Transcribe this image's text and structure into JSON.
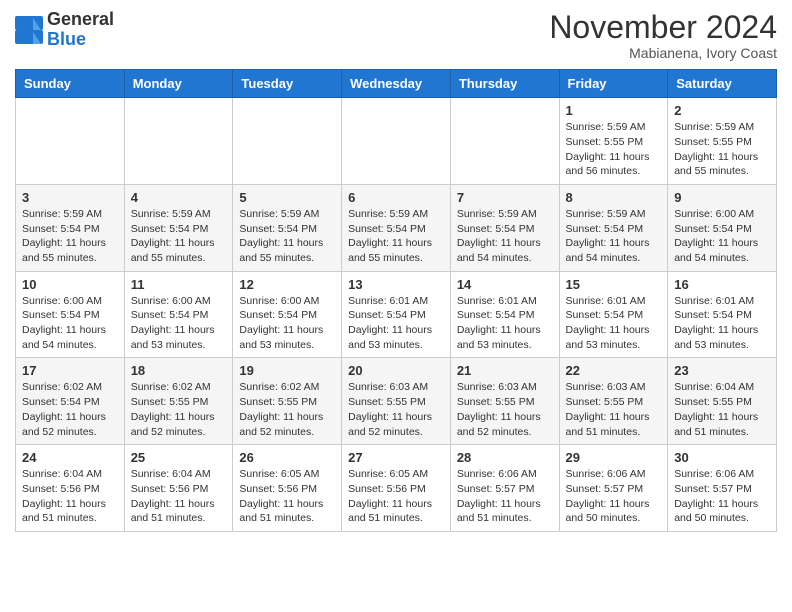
{
  "header": {
    "logo_general": "General",
    "logo_blue": "Blue",
    "month_title": "November 2024",
    "location": "Mabianena, Ivory Coast"
  },
  "weekdays": [
    "Sunday",
    "Monday",
    "Tuesday",
    "Wednesday",
    "Thursday",
    "Friday",
    "Saturday"
  ],
  "weeks": [
    [
      {
        "day": "",
        "info": ""
      },
      {
        "day": "",
        "info": ""
      },
      {
        "day": "",
        "info": ""
      },
      {
        "day": "",
        "info": ""
      },
      {
        "day": "",
        "info": ""
      },
      {
        "day": "1",
        "info": "Sunrise: 5:59 AM\nSunset: 5:55 PM\nDaylight: 11 hours\nand 56 minutes."
      },
      {
        "day": "2",
        "info": "Sunrise: 5:59 AM\nSunset: 5:55 PM\nDaylight: 11 hours\nand 55 minutes."
      }
    ],
    [
      {
        "day": "3",
        "info": "Sunrise: 5:59 AM\nSunset: 5:54 PM\nDaylight: 11 hours\nand 55 minutes."
      },
      {
        "day": "4",
        "info": "Sunrise: 5:59 AM\nSunset: 5:54 PM\nDaylight: 11 hours\nand 55 minutes."
      },
      {
        "day": "5",
        "info": "Sunrise: 5:59 AM\nSunset: 5:54 PM\nDaylight: 11 hours\nand 55 minutes."
      },
      {
        "day": "6",
        "info": "Sunrise: 5:59 AM\nSunset: 5:54 PM\nDaylight: 11 hours\nand 55 minutes."
      },
      {
        "day": "7",
        "info": "Sunrise: 5:59 AM\nSunset: 5:54 PM\nDaylight: 11 hours\nand 54 minutes."
      },
      {
        "day": "8",
        "info": "Sunrise: 5:59 AM\nSunset: 5:54 PM\nDaylight: 11 hours\nand 54 minutes."
      },
      {
        "day": "9",
        "info": "Sunrise: 6:00 AM\nSunset: 5:54 PM\nDaylight: 11 hours\nand 54 minutes."
      }
    ],
    [
      {
        "day": "10",
        "info": "Sunrise: 6:00 AM\nSunset: 5:54 PM\nDaylight: 11 hours\nand 54 minutes."
      },
      {
        "day": "11",
        "info": "Sunrise: 6:00 AM\nSunset: 5:54 PM\nDaylight: 11 hours\nand 53 minutes."
      },
      {
        "day": "12",
        "info": "Sunrise: 6:00 AM\nSunset: 5:54 PM\nDaylight: 11 hours\nand 53 minutes."
      },
      {
        "day": "13",
        "info": "Sunrise: 6:01 AM\nSunset: 5:54 PM\nDaylight: 11 hours\nand 53 minutes."
      },
      {
        "day": "14",
        "info": "Sunrise: 6:01 AM\nSunset: 5:54 PM\nDaylight: 11 hours\nand 53 minutes."
      },
      {
        "day": "15",
        "info": "Sunrise: 6:01 AM\nSunset: 5:54 PM\nDaylight: 11 hours\nand 53 minutes."
      },
      {
        "day": "16",
        "info": "Sunrise: 6:01 AM\nSunset: 5:54 PM\nDaylight: 11 hours\nand 53 minutes."
      }
    ],
    [
      {
        "day": "17",
        "info": "Sunrise: 6:02 AM\nSunset: 5:54 PM\nDaylight: 11 hours\nand 52 minutes."
      },
      {
        "day": "18",
        "info": "Sunrise: 6:02 AM\nSunset: 5:55 PM\nDaylight: 11 hours\nand 52 minutes."
      },
      {
        "day": "19",
        "info": "Sunrise: 6:02 AM\nSunset: 5:55 PM\nDaylight: 11 hours\nand 52 minutes."
      },
      {
        "day": "20",
        "info": "Sunrise: 6:03 AM\nSunset: 5:55 PM\nDaylight: 11 hours\nand 52 minutes."
      },
      {
        "day": "21",
        "info": "Sunrise: 6:03 AM\nSunset: 5:55 PM\nDaylight: 11 hours\nand 52 minutes."
      },
      {
        "day": "22",
        "info": "Sunrise: 6:03 AM\nSunset: 5:55 PM\nDaylight: 11 hours\nand 51 minutes."
      },
      {
        "day": "23",
        "info": "Sunrise: 6:04 AM\nSunset: 5:55 PM\nDaylight: 11 hours\nand 51 minutes."
      }
    ],
    [
      {
        "day": "24",
        "info": "Sunrise: 6:04 AM\nSunset: 5:56 PM\nDaylight: 11 hours\nand 51 minutes."
      },
      {
        "day": "25",
        "info": "Sunrise: 6:04 AM\nSunset: 5:56 PM\nDaylight: 11 hours\nand 51 minutes."
      },
      {
        "day": "26",
        "info": "Sunrise: 6:05 AM\nSunset: 5:56 PM\nDaylight: 11 hours\nand 51 minutes."
      },
      {
        "day": "27",
        "info": "Sunrise: 6:05 AM\nSunset: 5:56 PM\nDaylight: 11 hours\nand 51 minutes."
      },
      {
        "day": "28",
        "info": "Sunrise: 6:06 AM\nSunset: 5:57 PM\nDaylight: 11 hours\nand 51 minutes."
      },
      {
        "day": "29",
        "info": "Sunrise: 6:06 AM\nSunset: 5:57 PM\nDaylight: 11 hours\nand 50 minutes."
      },
      {
        "day": "30",
        "info": "Sunrise: 6:06 AM\nSunset: 5:57 PM\nDaylight: 11 hours\nand 50 minutes."
      }
    ]
  ]
}
